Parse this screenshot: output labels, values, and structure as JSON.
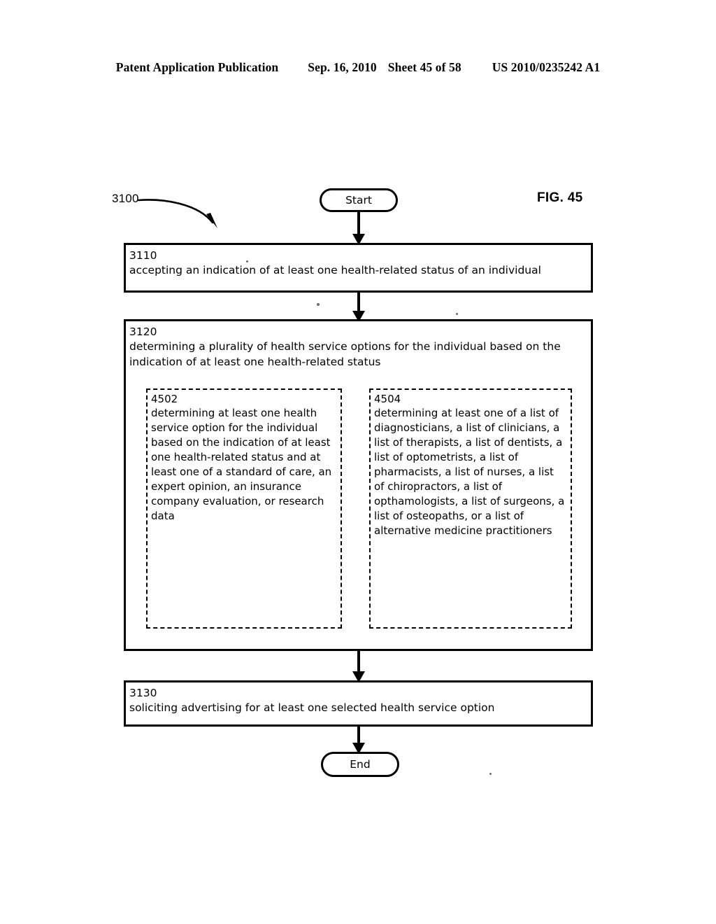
{
  "header": {
    "publication": "Patent Application Publication",
    "date": "Sep. 16, 2010",
    "sheet": "Sheet 45 of 58",
    "patent_number": "US 2010/0235242 A1"
  },
  "figure": {
    "label": "FIG. 45",
    "flow_reference": "3100"
  },
  "flowchart": {
    "start": "Start",
    "end": "End",
    "steps": [
      {
        "number": "3110",
        "text": "accepting an indication of at least one health-related status of an individual"
      },
      {
        "number": "3120",
        "text": "determining a plurality of health service options for the individual based on the indication of at least one health-related status",
        "substeps": [
          {
            "number": "4502",
            "text": "determining at least one health service option for the individual based on the indication of at least one health-related status and at least one of a standard of care, an expert opinion, an insurance company evaluation, or research data"
          },
          {
            "number": "4504",
            "text": "determining at least one of a list of diagnosticians, a list of clinicians, a list of therapists, a list of dentists, a list of optometrists, a list of pharmacists, a list of nurses, a list of chiropractors, a list of opthamologists, a list of surgeons, a list of osteopaths, or a list of alternative medicine practitioners"
          }
        ]
      },
      {
        "number": "3130",
        "text": "soliciting advertising for at least one selected health service option"
      }
    ]
  },
  "colors": {
    "ink": "#000000",
    "page": "#ffffff"
  }
}
